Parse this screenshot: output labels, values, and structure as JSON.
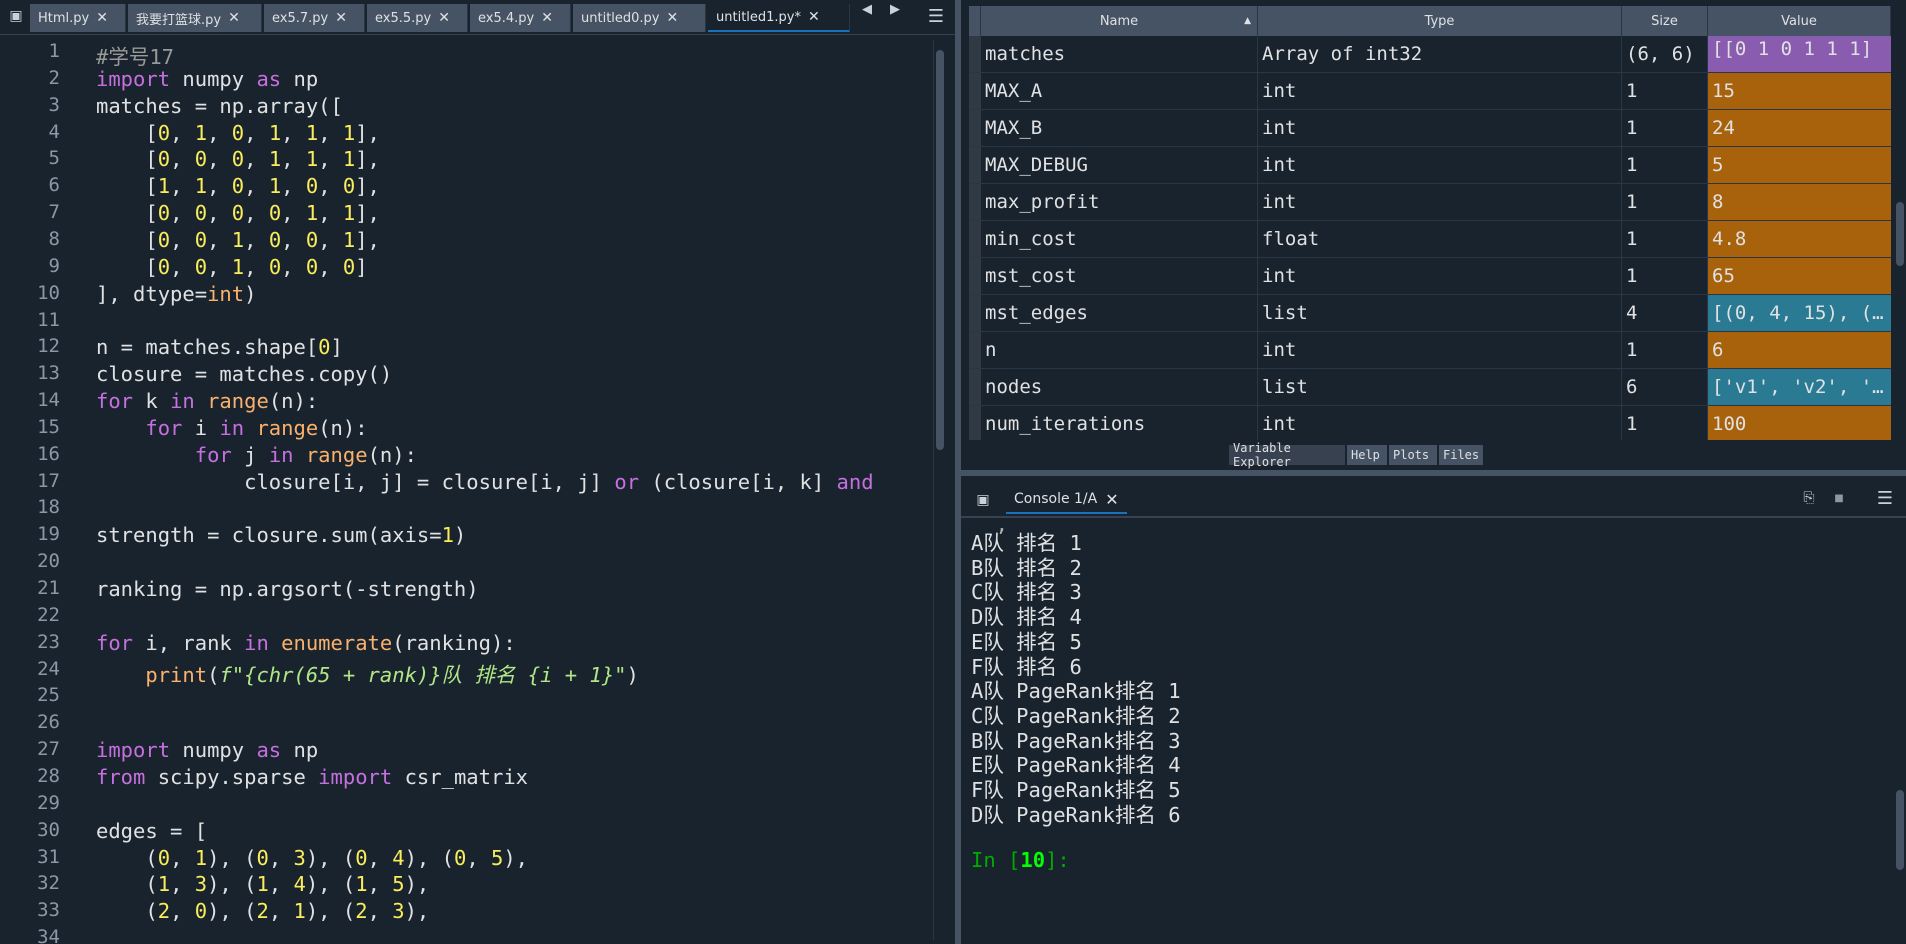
{
  "editor": {
    "tabs": [
      {
        "label": "Html.py",
        "active": false
      },
      {
        "label": "我要打篮球.py",
        "active": false
      },
      {
        "label": "ex5.7.py",
        "active": false
      },
      {
        "label": "ex5.5.py",
        "active": false
      },
      {
        "label": "ex5.4.py",
        "active": false
      },
      {
        "label": "untitled0.py",
        "active": false
      },
      {
        "label": "untitled1.py*",
        "active": true
      }
    ],
    "lines": [
      {
        "n": "1",
        "t": [
          [
            "cm",
            "#学号17"
          ]
        ]
      },
      {
        "n": "2",
        "t": [
          [
            "kw",
            "import"
          ],
          [
            "",
            " numpy "
          ],
          [
            "kw",
            "as"
          ],
          [
            "",
            " np"
          ]
        ]
      },
      {
        "n": "3",
        "t": [
          [
            "",
            "matches = np.array(["
          ]
        ]
      },
      {
        "n": "4",
        "t": [
          [
            "",
            "    ["
          ],
          [
            "nm",
            "0"
          ],
          [
            "",
            ", "
          ],
          [
            "nm",
            "1"
          ],
          [
            "",
            ", "
          ],
          [
            "nm",
            "0"
          ],
          [
            "",
            ", "
          ],
          [
            "nm",
            "1"
          ],
          [
            "",
            ", "
          ],
          [
            "nm",
            "1"
          ],
          [
            "",
            ", "
          ],
          [
            "nm",
            "1"
          ],
          [
            "",
            "],"
          ]
        ]
      },
      {
        "n": "5",
        "t": [
          [
            "",
            "    ["
          ],
          [
            "nm",
            "0"
          ],
          [
            "",
            ", "
          ],
          [
            "nm",
            "0"
          ],
          [
            "",
            ", "
          ],
          [
            "nm",
            "0"
          ],
          [
            "",
            ", "
          ],
          [
            "nm",
            "1"
          ],
          [
            "",
            ", "
          ],
          [
            "nm",
            "1"
          ],
          [
            "",
            ", "
          ],
          [
            "nm",
            "1"
          ],
          [
            "",
            "],"
          ]
        ]
      },
      {
        "n": "6",
        "t": [
          [
            "",
            "    ["
          ],
          [
            "nm",
            "1"
          ],
          [
            "",
            ", "
          ],
          [
            "nm",
            "1"
          ],
          [
            "",
            ", "
          ],
          [
            "nm",
            "0"
          ],
          [
            "",
            ", "
          ],
          [
            "nm",
            "1"
          ],
          [
            "",
            ", "
          ],
          [
            "nm",
            "0"
          ],
          [
            "",
            ", "
          ],
          [
            "nm",
            "0"
          ],
          [
            "",
            "],"
          ]
        ]
      },
      {
        "n": "7",
        "t": [
          [
            "",
            "    ["
          ],
          [
            "nm",
            "0"
          ],
          [
            "",
            ", "
          ],
          [
            "nm",
            "0"
          ],
          [
            "",
            ", "
          ],
          [
            "nm",
            "0"
          ],
          [
            "",
            ", "
          ],
          [
            "nm",
            "0"
          ],
          [
            "",
            ", "
          ],
          [
            "nm",
            "1"
          ],
          [
            "",
            ", "
          ],
          [
            "nm",
            "1"
          ],
          [
            "",
            "],"
          ]
        ]
      },
      {
        "n": "8",
        "t": [
          [
            "",
            "    ["
          ],
          [
            "nm",
            "0"
          ],
          [
            "",
            ", "
          ],
          [
            "nm",
            "0"
          ],
          [
            "",
            ", "
          ],
          [
            "nm",
            "1"
          ],
          [
            "",
            ", "
          ],
          [
            "nm",
            "0"
          ],
          [
            "",
            ", "
          ],
          [
            "nm",
            "0"
          ],
          [
            "",
            ", "
          ],
          [
            "nm",
            "1"
          ],
          [
            "",
            "],"
          ]
        ]
      },
      {
        "n": "9",
        "t": [
          [
            "",
            "    ["
          ],
          [
            "nm",
            "0"
          ],
          [
            "",
            ", "
          ],
          [
            "nm",
            "0"
          ],
          [
            "",
            ", "
          ],
          [
            "nm",
            "1"
          ],
          [
            "",
            ", "
          ],
          [
            "nm",
            "0"
          ],
          [
            "",
            ", "
          ],
          [
            "nm",
            "0"
          ],
          [
            "",
            ", "
          ],
          [
            "nm",
            "0"
          ],
          [
            "",
            "]"
          ]
        ]
      },
      {
        "n": "10",
        "t": [
          [
            "",
            "], dtype="
          ],
          [
            "bi",
            "int"
          ],
          [
            "",
            ")"
          ]
        ]
      },
      {
        "n": "11",
        "t": []
      },
      {
        "n": "12",
        "t": [
          [
            "",
            "n = matches.shape["
          ],
          [
            "nm",
            "0"
          ],
          [
            "",
            "]"
          ]
        ]
      },
      {
        "n": "13",
        "t": [
          [
            "",
            "closure = matches.copy()"
          ]
        ]
      },
      {
        "n": "14",
        "t": [
          [
            "kw",
            "for"
          ],
          [
            "",
            " k "
          ],
          [
            "kw",
            "in"
          ],
          [
            "",
            " "
          ],
          [
            "bi",
            "range"
          ],
          [
            "",
            "(n):"
          ]
        ]
      },
      {
        "n": "15",
        "t": [
          [
            "",
            "    "
          ],
          [
            "kw",
            "for"
          ],
          [
            "",
            " i "
          ],
          [
            "kw",
            "in"
          ],
          [
            "",
            " "
          ],
          [
            "bi",
            "range"
          ],
          [
            "",
            "(n):"
          ]
        ]
      },
      {
        "n": "16",
        "t": [
          [
            "",
            "        "
          ],
          [
            "kw",
            "for"
          ],
          [
            "",
            " j "
          ],
          [
            "kw",
            "in"
          ],
          [
            "",
            " "
          ],
          [
            "bi",
            "range"
          ],
          [
            "",
            "(n):"
          ]
        ]
      },
      {
        "n": "17",
        "t": [
          [
            "",
            "            closure[i, j] = closure[i, j] "
          ],
          [
            "kw",
            "or"
          ],
          [
            "",
            " (closure[i, k] "
          ],
          [
            "kw",
            "and"
          ]
        ]
      },
      {
        "n": "18",
        "t": []
      },
      {
        "n": "19",
        "t": [
          [
            "",
            "strength = closure.sum(axis="
          ],
          [
            "nm",
            "1"
          ],
          [
            "",
            ")"
          ]
        ]
      },
      {
        "n": "20",
        "t": []
      },
      {
        "n": "21",
        "t": [
          [
            "",
            "ranking = np.argsort(-strength)"
          ]
        ]
      },
      {
        "n": "22",
        "t": []
      },
      {
        "n": "23",
        "t": [
          [
            "kw",
            "for"
          ],
          [
            "",
            " i, rank "
          ],
          [
            "kw",
            "in"
          ],
          [
            "",
            " "
          ],
          [
            "bi",
            "enumerate"
          ],
          [
            "",
            "(ranking):"
          ]
        ]
      },
      {
        "n": "24",
        "t": [
          [
            "",
            "    "
          ],
          [
            "bi",
            "print"
          ],
          [
            "",
            "("
          ],
          [
            "st",
            "f\"{chr(65 + rank)}队 排名 {i + 1}\""
          ],
          [
            "",
            ")"
          ]
        ]
      },
      {
        "n": "25",
        "t": []
      },
      {
        "n": "26",
        "t": []
      },
      {
        "n": "27",
        "t": [
          [
            "kw",
            "import"
          ],
          [
            "",
            " numpy "
          ],
          [
            "kw",
            "as"
          ],
          [
            "",
            " np"
          ]
        ]
      },
      {
        "n": "28",
        "t": [
          [
            "kw",
            "from"
          ],
          [
            "",
            " scipy.sparse "
          ],
          [
            "kw",
            "import"
          ],
          [
            "",
            " csr_matrix"
          ]
        ]
      },
      {
        "n": "29",
        "t": []
      },
      {
        "n": "30",
        "t": [
          [
            "",
            "edges = ["
          ]
        ]
      },
      {
        "n": "31",
        "t": [
          [
            "",
            "    ("
          ],
          [
            "nm",
            "0"
          ],
          [
            "",
            ", "
          ],
          [
            "nm",
            "1"
          ],
          [
            "",
            "), ("
          ],
          [
            "nm",
            "0"
          ],
          [
            "",
            ", "
          ],
          [
            "nm",
            "3"
          ],
          [
            "",
            "), ("
          ],
          [
            "nm",
            "0"
          ],
          [
            "",
            ", "
          ],
          [
            "nm",
            "4"
          ],
          [
            "",
            "), ("
          ],
          [
            "nm",
            "0"
          ],
          [
            "",
            ", "
          ],
          [
            "nm",
            "5"
          ],
          [
            "",
            "),"
          ]
        ]
      },
      {
        "n": "32",
        "t": [
          [
            "",
            "    ("
          ],
          [
            "nm",
            "1"
          ],
          [
            "",
            ", "
          ],
          [
            "nm",
            "3"
          ],
          [
            "",
            "), ("
          ],
          [
            "nm",
            "1"
          ],
          [
            "",
            ", "
          ],
          [
            "nm",
            "4"
          ],
          [
            "",
            "), ("
          ],
          [
            "nm",
            "1"
          ],
          [
            "",
            ", "
          ],
          [
            "nm",
            "5"
          ],
          [
            "",
            "),"
          ]
        ]
      },
      {
        "n": "33",
        "t": [
          [
            "",
            "    ("
          ],
          [
            "nm",
            "2"
          ],
          [
            "",
            ", "
          ],
          [
            "nm",
            "0"
          ],
          [
            "",
            "), ("
          ],
          [
            "nm",
            "2"
          ],
          [
            "",
            ", "
          ],
          [
            "nm",
            "1"
          ],
          [
            "",
            "), ("
          ],
          [
            "nm",
            "2"
          ],
          [
            "",
            ", "
          ],
          [
            "nm",
            "3"
          ],
          [
            "",
            "),"
          ]
        ]
      },
      {
        "n": "34",
        "t": []
      }
    ]
  },
  "variables": {
    "headers": {
      "name": "Name",
      "type": "Type",
      "size": "Size",
      "value": "Value"
    },
    "rows": [
      {
        "name": "matches",
        "type": "Array of int32",
        "size": "(6, 6)",
        "value": "[[0 1 0 1 1 1]",
        "color": "#8a5cb0"
      },
      {
        "name": "MAX_A",
        "type": "int",
        "size": "1",
        "value": "15",
        "color": "#a8620c"
      },
      {
        "name": "MAX_B",
        "type": "int",
        "size": "1",
        "value": "24",
        "color": "#a8620c"
      },
      {
        "name": "MAX_DEBUG",
        "type": "int",
        "size": "1",
        "value": "5",
        "color": "#a8620c"
      },
      {
        "name": "max_profit",
        "type": "int",
        "size": "1",
        "value": "8",
        "color": "#a8620c"
      },
      {
        "name": "min_cost",
        "type": "float",
        "size": "1",
        "value": "4.8",
        "color": "#a8620c"
      },
      {
        "name": "mst_cost",
        "type": "int",
        "size": "1",
        "value": "65",
        "color": "#a8620c"
      },
      {
        "name": "mst_edges",
        "type": "list",
        "size": "4",
        "value": "[(0, 4, 15), (…",
        "color": "#2a7a94"
      },
      {
        "name": "n",
        "type": "int",
        "size": "1",
        "value": "6",
        "color": "#a8620c"
      },
      {
        "name": "nodes",
        "type": "list",
        "size": "6",
        "value": "['v1', 'v2', '…",
        "color": "#2a7a94"
      },
      {
        "name": "num_iterations",
        "type": "int",
        "size": "1",
        "value": "100",
        "color": "#a8620c"
      }
    ],
    "pane_tabs": [
      "Variable Explorer",
      "Help",
      "Plots",
      "Files"
    ]
  },
  "console": {
    "tab_label": "Console 1/A",
    "lines": [
      "A队 排名 1",
      "B队 排名 2",
      "C队 排名 3",
      "D队 排名 4",
      "E队 排名 5",
      "F队 排名 6",
      "A队 PageRank排名 1",
      "C队 PageRank排名 2",
      "B队 PageRank排名 3",
      "E队 PageRank排名 4",
      "F队 PageRank排名 5",
      "D队 PageRank排名 6"
    ],
    "prompt_label": "In [",
    "prompt_number": "10",
    "prompt_suffix": "]:"
  }
}
